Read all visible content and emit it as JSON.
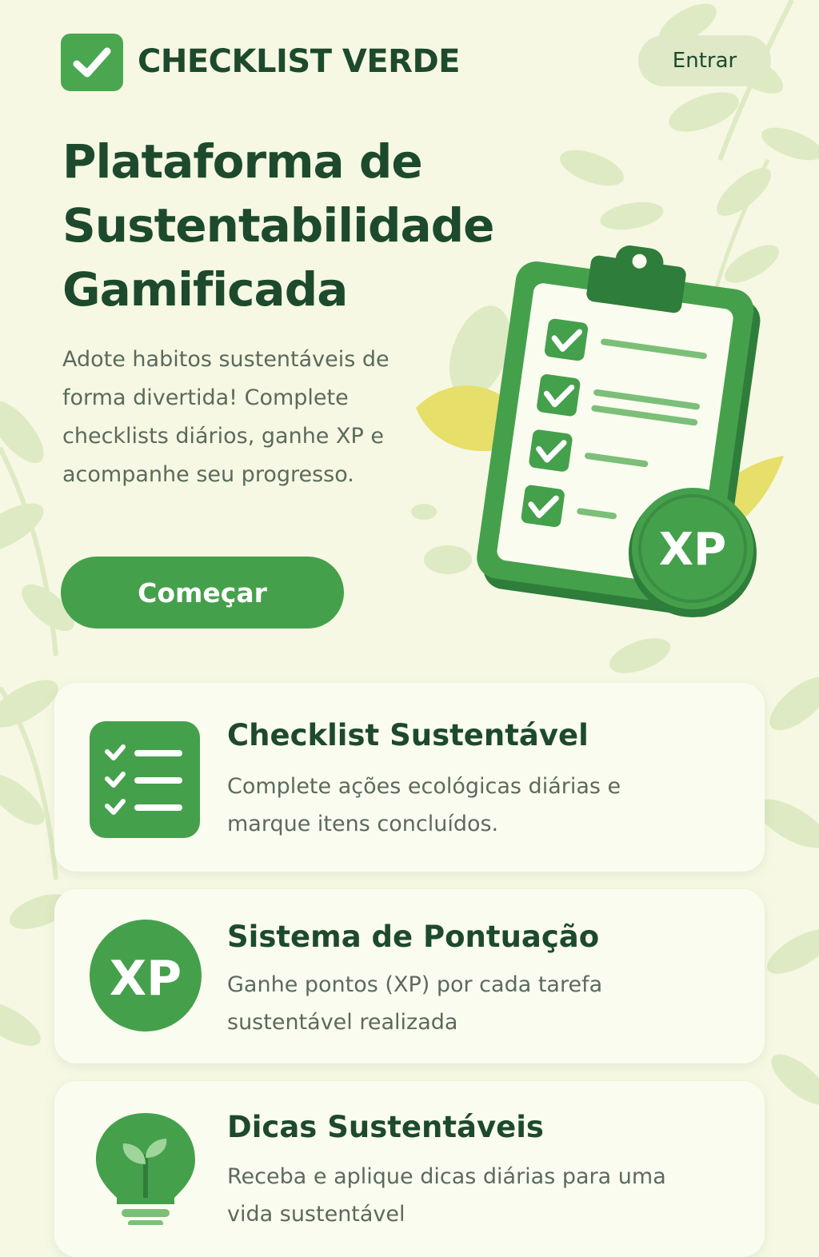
{
  "header": {
    "brand": "CHECKLIST VERDE",
    "login_label": "Entrar"
  },
  "hero": {
    "title_lines": [
      "Plataforma de",
      "Sustentabilidade",
      "Gamificada"
    ],
    "description": "Adote habitos sustentáveis de forma divertida! Complete checklists diários, ganhe XP e acompanhe seu progresso.",
    "cta_label": "Começar",
    "badge_text": "XP"
  },
  "features": [
    {
      "icon": "checklist-icon",
      "title": "Checklist Sustentável",
      "description": "Complete ações ecológicas diárias e marque itens concluídos."
    },
    {
      "icon": "xp-badge-icon",
      "icon_text": "XP",
      "title": "Sistema de Pontuação",
      "description": "Ganhe pontos (XP) por cada tarefa sustentável realizada"
    },
    {
      "icon": "lightbulb-leaf-icon",
      "title": "Dicas Sustentáveis",
      "description": "Receba e aplique dicas diárias para uma vida sustentável"
    }
  ],
  "colors": {
    "background": "#f6f8e3",
    "primary_green": "#45a04c",
    "dark_green": "#1d4a2c",
    "light_green": "#dfe9c8",
    "leaf_yellow": "#e6df6a"
  }
}
